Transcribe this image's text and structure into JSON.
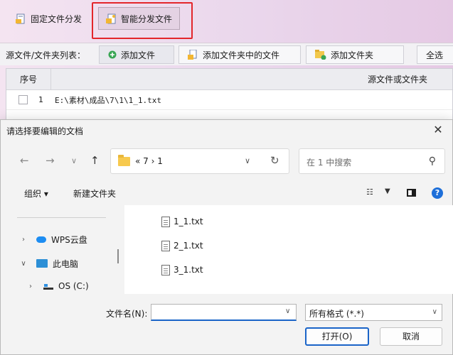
{
  "app": {
    "modes": [
      {
        "label": "固定文件分发",
        "icon": "document-icon"
      },
      {
        "label": "智能分发文件",
        "icon": "smart-document-icon"
      }
    ],
    "source_label": "源文件/文件夹列表：",
    "source_buttons": [
      {
        "label": "添加文件",
        "icon": "plus-circle-icon"
      },
      {
        "label": "添加文件夹中的文件",
        "icon": "folder-files-icon"
      },
      {
        "label": "添加文件夹",
        "icon": "folder-add-icon"
      },
      {
        "label": "全选"
      }
    ],
    "table": {
      "headers": [
        "序号",
        "源文件或文件夹"
      ],
      "rows": [
        {
          "index": "1",
          "path": "E:\\素材\\成品\\7\\1\\1_1.txt",
          "checked": false
        }
      ]
    },
    "accent_color": "#e3262b"
  },
  "dialog": {
    "title": "请选择要编辑的文档",
    "close": "✕",
    "address": {
      "path": "« 7 › 1"
    },
    "search": {
      "placeholder": "在 1 中搜索"
    },
    "commands": {
      "organize": "组织 ▾",
      "new_folder": "新建文件夹"
    },
    "nav_tree": [
      {
        "label": "WPS云盘",
        "expanded": false,
        "icon": "cloud-icon"
      },
      {
        "label": "此电脑",
        "expanded": true,
        "icon": "computer-icon"
      },
      {
        "label": "OS (C:)",
        "expanded": false,
        "icon": "drive-icon"
      }
    ],
    "files": [
      {
        "name": "1_1.txt",
        "icon": "text-file-icon"
      },
      {
        "name": "2_1.txt",
        "icon": "text-file-icon"
      },
      {
        "name": "3_1.txt",
        "icon": "text-file-icon"
      }
    ],
    "filename_label": "文件名(N):",
    "filename_value": "",
    "filetype": "所有格式 (*.*)",
    "open_button": "打开(O)",
    "cancel_button": "取消",
    "accent_color": "#1a64c8"
  }
}
